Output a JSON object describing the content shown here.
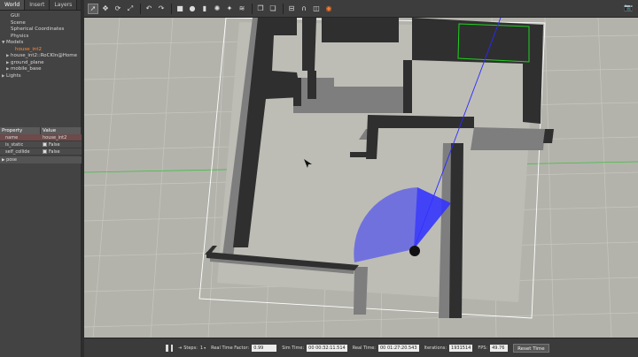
{
  "tabs": [
    "World",
    "Insert",
    "Layers"
  ],
  "tree": [
    {
      "label": "GUI",
      "indent": 1,
      "arrow": ""
    },
    {
      "label": "Scene",
      "indent": 1,
      "arrow": ""
    },
    {
      "label": "Spherical Coordinates",
      "indent": 1,
      "arrow": ""
    },
    {
      "label": "Physics",
      "indent": 1,
      "arrow": ""
    },
    {
      "label": "Models",
      "indent": 0,
      "arrow": "▼"
    },
    {
      "label": "house_int2",
      "indent": 2,
      "arrow": "",
      "selected": true
    },
    {
      "label": "house_int2::RoCKIn@Home",
      "indent": 1,
      "arrow": "▶"
    },
    {
      "label": "ground_plane",
      "indent": 1,
      "arrow": "▶"
    },
    {
      "label": "mobile_base",
      "indent": 1,
      "arrow": "▶"
    },
    {
      "label": "Lights",
      "indent": 0,
      "arrow": "▶"
    }
  ],
  "properties": {
    "header": {
      "property": "Property",
      "value": "Value"
    },
    "rows": [
      {
        "name": "name",
        "value": "house_int2",
        "checkbox": false,
        "red": true
      },
      {
        "name": "is_static",
        "value": "False",
        "checkbox": true,
        "red": false
      },
      {
        "name": "self_collide",
        "value": "False",
        "checkbox": true,
        "red": false
      }
    ],
    "pose_label": "pose"
  },
  "toolbar": {
    "icons": [
      "select-arrow-icon",
      "translate-icon",
      "rotate-icon",
      "scale-icon",
      "undo-icon",
      "redo-icon",
      "box-icon",
      "sphere-icon",
      "cylinder-icon",
      "point-light-icon",
      "spot-light-icon",
      "directional-light-icon",
      "copy-icon",
      "paste-icon",
      "align-icon",
      "snap-icon",
      "change-view-icon",
      "screenshot-icon"
    ],
    "right_icon": "camera-icon"
  },
  "bottombar": {
    "steps_label": "Steps:",
    "steps_value": "1",
    "rtf_label": "Real Time Factor:",
    "rtf_value": "0.99",
    "sim_time_label": "Sim Time:",
    "sim_time_value": "00 00:32:11.514",
    "real_time_label": "Real Time:",
    "real_time_value": "00 01:27:20.543",
    "iterations_label": "Iterations:",
    "iterations_value": "1931514",
    "fps_label": "FPS:",
    "fps_value": "49.76",
    "reset_label": "Reset Time"
  },
  "colors": {
    "ground": "#b3b3ac",
    "wall_top": "#2f2f2f",
    "wall_side": "#7e7e7e",
    "laser": "#3333ff",
    "selected_text": "#ff8c3a"
  }
}
